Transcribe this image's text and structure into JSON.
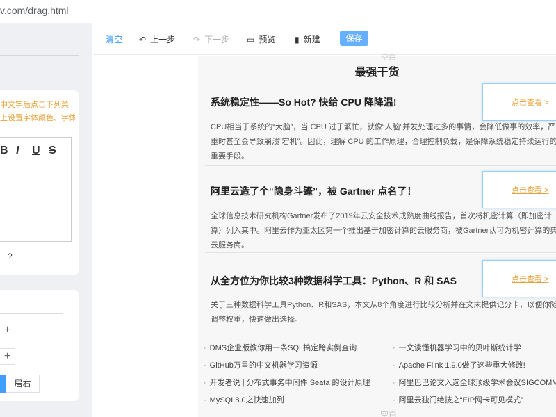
{
  "browser": {
    "url": "v.com/drag.html"
  },
  "left_panel": {
    "tip_line1": "中文字后点击下列菜",
    "tip_line2": "上设置字体颜色、字体",
    "format_buttons": [
      "B",
      "I",
      "U",
      "S"
    ],
    "help": "?",
    "steppers": [
      "+",
      "+"
    ],
    "align_right": "居右"
  },
  "toolbar": {
    "clear": "清空",
    "undo": "上一步",
    "redo": "下一步",
    "preview": "预览",
    "new": "新建",
    "save": "保存"
  },
  "content": {
    "blank_top": "空白",
    "section_title": "最强干货",
    "view_label": "点击查看 >",
    "articles": [
      {
        "title": "系统稳定性——So Hot? 快给 CPU 降降温!",
        "desc": [
          "CPU相当于系统的“大脑”，当 CPU 过于繁忙，就像“人脑”并发处理过多的事情，会降低做事的效率，严",
          "重时甚至会导致崩溃“宕机”。因此，理解 CPU 的工作原理，合理控制负载，是保障系统稳定持续运行的",
          "重要手段。"
        ]
      },
      {
        "title": "阿里云造了个“隐身斗篷”，被 Gartner 点名了！",
        "desc": [
          "全球信息技术研究机构Gartner发布了2019年云安全技术成熟度曲线报告，首次将机密计算（即加密计",
          "算）列入其中。阿里云作为亚太区第一个推出基于加密计算的云服务商，被Gartner认可为机密计算的典",
          "云服务商。"
        ]
      },
      {
        "title": "从全方位为你比较3种数据科学工具：Python、R 和 SAS",
        "desc": [
          "关于三种数据科学工具Python、R和SAS，本文从8个角度进行比较分析并在文末提供记分卡，以便你随时",
          "调整权重，快速做出选择。"
        ]
      }
    ],
    "links_left": [
      "DMS企业版教你用一条SQL搞定跨实例查询",
      "GitHub万星的中文机器学习资源",
      "开发者说 | 分布式事务中间件 Seata 的设计原理",
      "MySQL8.0之快速加列"
    ],
    "links_right": [
      "一文读懂机器学习中的贝叶斯统计学",
      "Apache Flink 1.9.0做了这些重大修改!",
      "阿里巴巴论文入选全球顶级学术会议SIGCOMM",
      "阿里云独门绝技之“EIP网卡可见模式”"
    ],
    "blank_bottom": "空白"
  }
}
